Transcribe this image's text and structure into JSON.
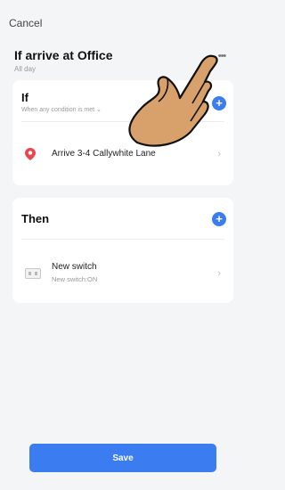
{
  "header": {
    "cancel_label": "Cancel",
    "title": "If arrive at Office",
    "subtitle": "All day",
    "more_label": "•••"
  },
  "if_card": {
    "heading": "If",
    "condition_mode": "When any condition is met ⌄",
    "add_label": "+",
    "condition": {
      "icon": "location-pin-icon",
      "label": "Arrive 3-4 Callywhite Lane",
      "chevron": "›"
    }
  },
  "then_card": {
    "heading": "Then",
    "add_label": "+",
    "action": {
      "icon": "switch-icon",
      "title": "New switch",
      "subtitle": "New switch:ON",
      "chevron": "›"
    }
  },
  "footer": {
    "save_label": "Save"
  },
  "colors": {
    "accent": "#3b7cf0",
    "pin": "#e8474f",
    "background": "#f4f5f7"
  },
  "overlay": {
    "icon": "pointing-hand-icon"
  }
}
